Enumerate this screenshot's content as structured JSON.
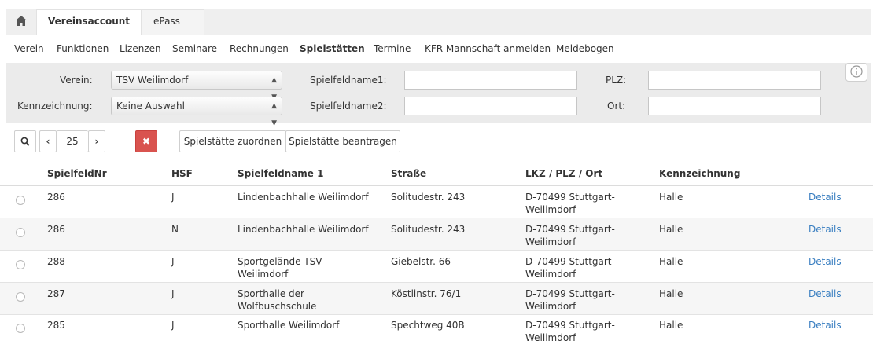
{
  "tabs": [
    {
      "label": "Vereinsaccount"
    },
    {
      "label": "ePass"
    }
  ],
  "subnav": [
    "Verein",
    "Funktionen",
    "Lizenzen",
    "Seminare",
    "Rechnungen",
    "Spielstätten",
    "Termine",
    "KFR Mannschaft anmelden",
    "Meldebogen"
  ],
  "filter": {
    "verein_label": "Verein:",
    "verein_value": "TSV Weilimdorf",
    "kennzeichnung_label": "Kennzeichnung:",
    "kennzeichnung_value": "Keine Auswahl",
    "spielfeldname1_label": "Spielfeldname1:",
    "spielfeldname2_label": "Spielfeldname2:",
    "plz_label": "PLZ:",
    "ort_label": "Ort:"
  },
  "toolbar": {
    "page_size": "25",
    "assign_label": "Spielstätte zuordnen",
    "apply_label": "Spielstätte beantragen"
  },
  "table": {
    "headers": [
      "SpielfeldNr",
      "HSF",
      "Spielfeldname 1",
      "Straße",
      "LKZ / PLZ / Ort",
      "Kennzeichnung"
    ],
    "rows": [
      {
        "nr": "286",
        "hsf": "J",
        "name": "Lindenbachhalle Weilimdorf",
        "strasse": "Solitudestr. 243",
        "ort": "D-70499 Stuttgart-Weilimdorf",
        "kenn": "Halle",
        "action": "Details"
      },
      {
        "nr": "286",
        "hsf": "N",
        "name": "Lindenbachhalle Weilimdorf",
        "strasse": "Solitudestr. 243",
        "ort": "D-70499 Stuttgart-Weilimdorf",
        "kenn": "Halle",
        "action": "Details"
      },
      {
        "nr": "288",
        "hsf": "J",
        "name": "Sportgelände TSV Weilimdorf",
        "strasse": "Giebelstr. 66",
        "ort": "D-70499 Stuttgart-Weilimdorf",
        "kenn": "Halle",
        "action": "Details"
      },
      {
        "nr": "287",
        "hsf": "J",
        "name": "Sporthalle der Wolfbuschschule",
        "strasse": "Köstlinstr. 76/1",
        "ort": "D-70499 Stuttgart-Weilimdorf",
        "kenn": "Halle",
        "action": "Details"
      },
      {
        "nr": "285",
        "hsf": "J",
        "name": "Sporthalle Weilimdorf",
        "strasse": "Spechtweg 40B",
        "ort": "D-70499 Stuttgart-Weilimdorf",
        "kenn": "Halle",
        "action": "Details"
      }
    ]
  },
  "icons": {
    "home": "home-icon",
    "search": "search-icon",
    "prev": "chevron-left-icon",
    "next": "chevron-right-icon",
    "clear": "close-icon",
    "info": "info-icon",
    "select": "updown-arrow-icon"
  },
  "colors": {
    "accent_link": "#3a7fc1",
    "danger": "#d9534f",
    "filter_bg": "#ebebeb",
    "tab_bar": "#efefef"
  }
}
